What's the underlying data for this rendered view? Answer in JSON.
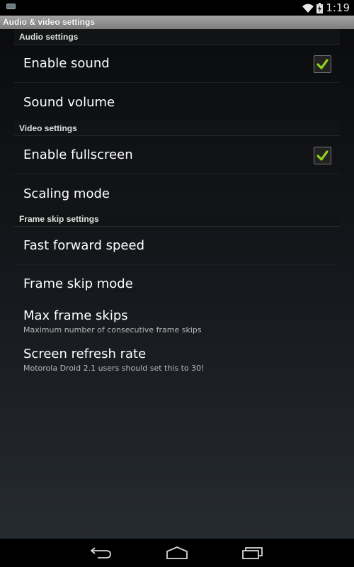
{
  "status_bar": {
    "time": "1:19",
    "icons": [
      "notification-icon",
      "wifi-icon",
      "battery-charging-icon"
    ]
  },
  "title_bar": {
    "title": "Audio & video settings"
  },
  "categories": {
    "audio": "Audio settings",
    "video": "Video settings",
    "frameskip": "Frame skip settings"
  },
  "preferences": [
    {
      "title": "Enable sound",
      "summary": "",
      "checkbox": true,
      "checked": true
    },
    {
      "title": "Sound volume",
      "summary": ""
    },
    {
      "title": "Enable fullscreen",
      "summary": "",
      "checkbox": true,
      "checked": true
    },
    {
      "title": "Scaling mode",
      "summary": ""
    },
    {
      "title": "Fast forward speed",
      "summary": ""
    },
    {
      "title": "Frame skip mode",
      "summary": ""
    },
    {
      "title": "Max frame skips",
      "summary": "Maximum number of consecutive frame skips"
    },
    {
      "title": "Screen refresh rate",
      "summary": "Motorola Droid 2.1 users should set this to 30!"
    }
  ],
  "nav_bar": {
    "buttons": [
      "back-icon",
      "home-icon",
      "recents-icon"
    ]
  },
  "colors": {
    "check_accent": "#8fd21e"
  }
}
